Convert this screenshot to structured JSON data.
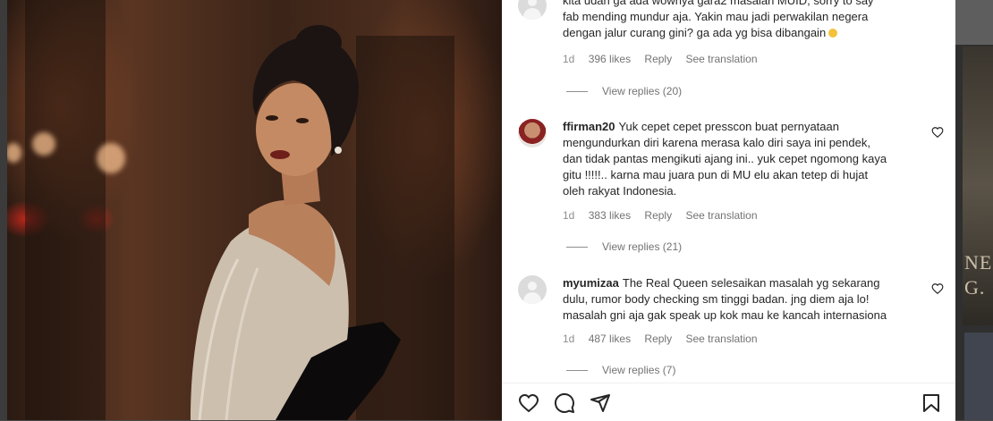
{
  "comments": [
    {
      "username": "",
      "text_lines": [
        "kita udah ga ada wownya gara2 masalah MUID, sorry to say",
        "fab mending mundur aja. Yakin mau jadi perwakilan negera",
        "dengan jalur curang gini? ga ada yg bisa dibangain"
      ],
      "emoji": "sad-face-emoji",
      "age": "1d",
      "likes": "396 likes",
      "reply": "Reply",
      "translate": "See translation",
      "view_replies": "View replies (20)"
    },
    {
      "username": "ffirman20",
      "text_lines": [
        "Yuk cepet cepet presscon buat pernyataan",
        "mengundurkan diri karena merasa kalo diri saya ini pendek,",
        "dan tidak pantas mengikuti ajang ini.. yuk cepet ngomong kaya",
        "gitu !!!!!.. karna mau juara pun di MU elu akan tetep di hujat",
        "oleh rakyat Indonesia."
      ],
      "age": "1d",
      "likes": "383 likes",
      "reply": "Reply",
      "translate": "See translation",
      "view_replies": "View replies (21)"
    },
    {
      "username": "myumizaa",
      "text_lines": [
        "The Real Queen selesaikan masalah yg sekarang",
        "dulu, rumor body checking sm tinggi badan. jng diem aja lo!",
        "masalah gni aja gak speak up kok mau ke kancah internasiona"
      ],
      "age": "1d",
      "likes": "487 likes",
      "reply": "Reply",
      "translate": "See translation",
      "view_replies": "View replies (7)"
    }
  ],
  "backdrop_text": [
    "NE",
    "G."
  ],
  "actions": {
    "like_icon": "heart-icon",
    "comment_icon": "comment-icon",
    "share_icon": "share-icon",
    "save_icon": "bookmark-icon"
  },
  "colors": {
    "text": "#262626",
    "secondary": "#8e8e8e"
  }
}
